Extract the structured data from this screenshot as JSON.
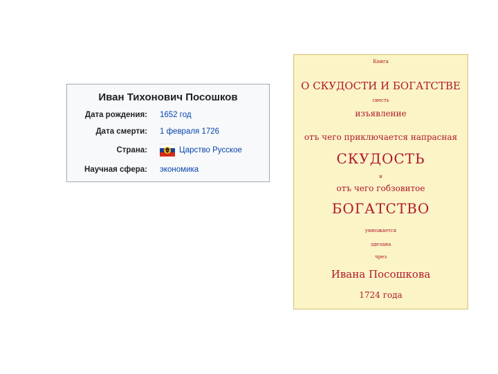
{
  "infobox": {
    "title": "Иван Тихонович Посошков",
    "rows": [
      {
        "label": "Дата рождения:",
        "value": "1652 год"
      },
      {
        "label": "Дата смерти:",
        "value": "1 февраля 1726"
      },
      {
        "label": "Страна:",
        "value": "Царство Русское",
        "flag_icon": "russian-tsardom-flag-icon"
      },
      {
        "label": "Научная сфера:",
        "value": "экономика"
      }
    ]
  },
  "manuscript": {
    "lines": [
      "Книга",
      "О СКУДОСТИ И БОГАТСТВЕ",
      "сиесть",
      "изъявление",
      "отъ чего приключается напрасная",
      "СКУДОСТЬ",
      "и",
      "отъ чего гобзовитое",
      "БОГАТСТВО",
      "умножается",
      "зделана",
      "чрез",
      "Ивана Посошкова",
      "1724 года"
    ],
    "ink_color": "#b0182a",
    "paper_color": "#fbf4c7"
  }
}
